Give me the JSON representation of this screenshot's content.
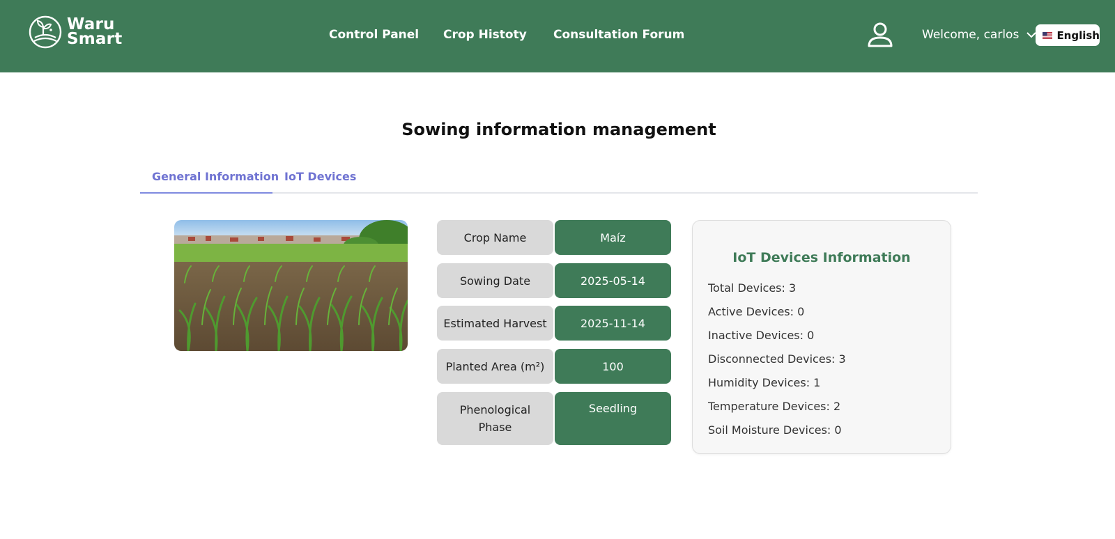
{
  "brand": {
    "line1": "Waru",
    "line2": "Smart",
    "icon": "sprout-logo-icon"
  },
  "nav": {
    "items": [
      {
        "label": "Control Panel"
      },
      {
        "label": "Crop Histoty"
      },
      {
        "label": "Consultation Forum"
      }
    ]
  },
  "user": {
    "welcome": "Welcome, carlos",
    "icon": "user-icon"
  },
  "language": {
    "label": "English",
    "icon": "us-flag-icon"
  },
  "page": {
    "title": "Sowing information management"
  },
  "tabs": [
    {
      "label": "General Information",
      "active": true
    },
    {
      "label": "IoT Devices",
      "active": false
    }
  ],
  "crop": {
    "fields": [
      {
        "label": "Crop Name",
        "value": "Maíz"
      },
      {
        "label": "Sowing Date",
        "value": "2025-05-14"
      },
      {
        "label": "Estimated Harvest",
        "value": "2025-11-14"
      },
      {
        "label": "Planted Area (m²)",
        "value": "100"
      },
      {
        "label_line1": "Phenological",
        "label_line2": "Phase",
        "value": "Seedling"
      }
    ]
  },
  "iot": {
    "title": "IoT Devices Information",
    "items": [
      "Total Devices: 3",
      "Active Devices: 0",
      "Inactive Devices: 0",
      "Disconnected Devices: 3",
      "Humidity Devices: 1",
      "Temperature Devices: 2",
      "Soil Moisture Devices: 0"
    ]
  },
  "colors": {
    "primary": "#3f7b58",
    "tab_accent": "#6f73d2",
    "label_bg": "#d9d9d9"
  }
}
